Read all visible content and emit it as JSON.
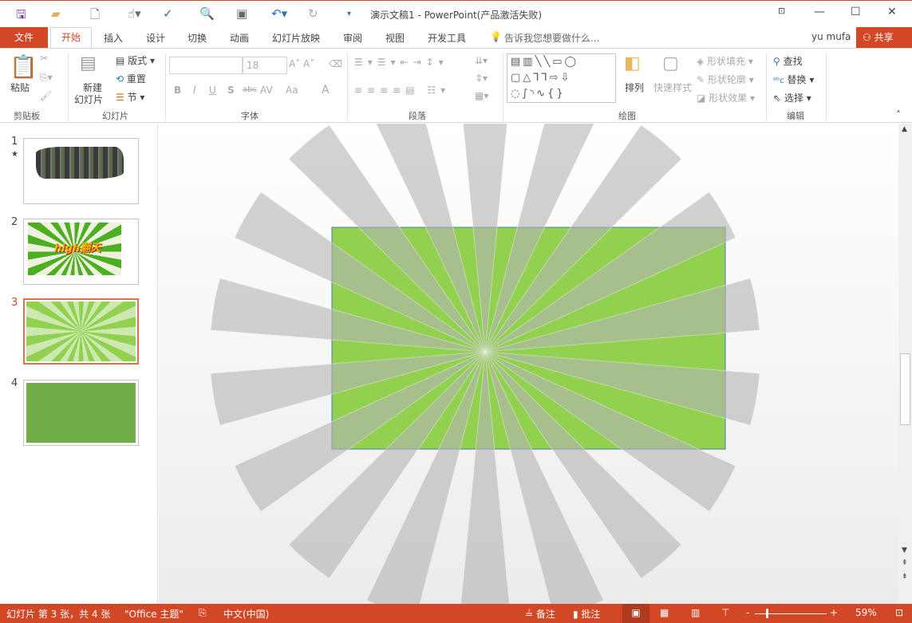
{
  "window": {
    "title": "演示文稿1 - PowerPoint(产品激活失败)"
  },
  "tabs": [
    "文件",
    "开始",
    "插入",
    "设计",
    "切换",
    "动画",
    "幻灯片放映",
    "审阅",
    "视图",
    "开发工具"
  ],
  "tell_me": "告诉我您想要做什么...",
  "user": "yu mufa",
  "share": "共享",
  "ribbon": {
    "clipboard": {
      "paste": "粘贴",
      "label": "剪贴板"
    },
    "slides": {
      "new_slide_1": "新建",
      "new_slide_2": "幻灯片",
      "layout": "版式",
      "reset": "重置",
      "section": "节",
      "label": "幻灯片"
    },
    "font": {
      "size": "18",
      "label": "字体",
      "bold": "B",
      "italic": "I",
      "underline": "U",
      "shadow": "S",
      "strike": "abc",
      "spacing": "AV",
      "case": "Aa",
      "color": "A"
    },
    "paragraph": {
      "label": "段落"
    },
    "drawing": {
      "arrange": "排列",
      "quick_styles": "快速样式",
      "fill": "形状填充",
      "outline": "形状轮廓",
      "effects": "形状效果",
      "label": "绘图"
    },
    "editing": {
      "find": "查找",
      "replace": "替换",
      "select": "选择",
      "label": "编辑"
    }
  },
  "slides": [
    {
      "num": "1",
      "star": "★"
    },
    {
      "num": "2",
      "text": "high翻天"
    },
    {
      "num": "3"
    },
    {
      "num": "4"
    }
  ],
  "selected_slide": 3,
  "colors": {
    "accent": "#d24726",
    "green": "#92d050",
    "ray": "#b4b4b4",
    "slide4": "#70ad47"
  },
  "status": {
    "slide_info": "幻灯片 第 3 张，共 4 张",
    "theme": "\"Office 主题\"",
    "language": "中文(中国)",
    "notes": "备注",
    "comments": "批注",
    "zoom": "59%"
  }
}
